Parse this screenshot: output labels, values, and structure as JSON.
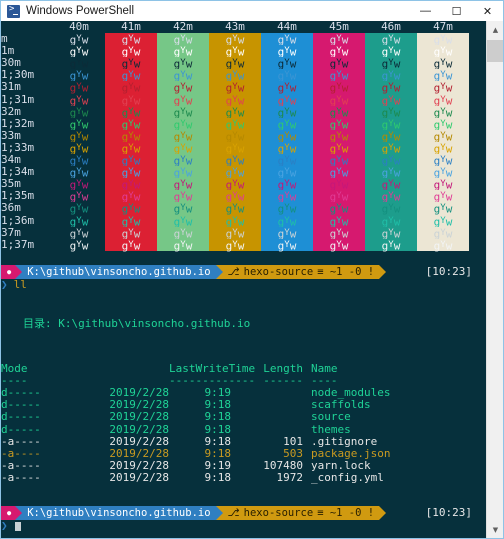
{
  "window": {
    "title": "Windows PowerShell",
    "icon": "powershell-icon",
    "minimize_label": "—",
    "maximize_label": "☐",
    "close_label": "✕"
  },
  "scrollbar": {
    "up_arrow": "▲",
    "down_arrow": "▼"
  },
  "color_chart": {
    "headers": [
      "",
      "40m",
      "41m",
      "42m",
      "43m",
      "44m",
      "45m",
      "46m",
      "47m"
    ],
    "sample_text": "gYw",
    "row_labels": [
      "m",
      "1m",
      "30m",
      "1;30m",
      "31m",
      "1;31m",
      "32m",
      "1;32m",
      "33m",
      "1;33m",
      "34m",
      "1;34m",
      "35m",
      "1;35m",
      "36m",
      "1;36m",
      "37m",
      "1;37m"
    ],
    "bg_colors": [
      "#06303c",
      "#dc2033",
      "#76c787",
      "#c79400",
      "#1e8fd5",
      "#d6196f",
      "#1d9d8c",
      "#ece6d4"
    ],
    "fg_colors": [
      "#d8dee9",
      "#ffffff",
      "#0c2b38",
      "#3b95d4",
      "#b32030",
      "#e14152",
      "#1d8a4e",
      "#2fcb6e",
      "#b58900",
      "#d8a200",
      "#2b7fc4",
      "#4aa3e0",
      "#c4187a",
      "#e03c95",
      "#14907f",
      "#1fbfa8",
      "#cbd3d6",
      "#f2f4f5"
    ]
  },
  "prompt_top": {
    "status_glyph": "●",
    "path": "K:\\github\\vinsoncho.github.io",
    "git_branch_glyph": "⎇",
    "git_branch": "hexo-source",
    "git_status": "≡ ~1 -0 !",
    "time": "[10:23]",
    "chevron": "❯",
    "command": "ll"
  },
  "listing": {
    "directory_label": "目录: K:\\github\\vinsoncho.github.io",
    "headers": {
      "mode": "Mode",
      "lastwritetime": "LastWriteTime",
      "length": "Length",
      "name": "Name"
    },
    "header_rules": {
      "mode": "----",
      "lastwritetime": "-------------",
      "length": "------",
      "name": "----"
    },
    "rows": [
      {
        "mode": "d-----",
        "date": "2019/2/28",
        "time": "9:19",
        "length": "",
        "name": "node_modules",
        "color": "#1fd396"
      },
      {
        "mode": "d-----",
        "date": "2019/2/28",
        "time": "9:18",
        "length": "",
        "name": "scaffolds",
        "color": "#1fd396"
      },
      {
        "mode": "d-----",
        "date": "2019/2/28",
        "time": "9:18",
        "length": "",
        "name": "source",
        "color": "#1fd396"
      },
      {
        "mode": "d-----",
        "date": "2019/2/28",
        "time": "9:18",
        "length": "",
        "name": "themes",
        "color": "#1fd396"
      },
      {
        "mode": "-a----",
        "date": "2019/2/28",
        "time": "9:18",
        "length": "101",
        "name": ".gitignore",
        "color": "#e6e6e6"
      },
      {
        "mode": "-a----",
        "date": "2019/2/28",
        "time": "9:18",
        "length": "503",
        "name": "package.json",
        "color": "#c99a21"
      },
      {
        "mode": "-a----",
        "date": "2019/2/28",
        "time": "9:19",
        "length": "107480",
        "name": "yarn.lock",
        "color": "#e6e6e6"
      },
      {
        "mode": "-a----",
        "date": "2019/2/28",
        "time": "9:18",
        "length": "1972",
        "name": "_config.yml",
        "color": "#e6e6e6"
      }
    ]
  },
  "prompt_bottom": {
    "status_glyph": "●",
    "path": "K:\\github\\vinsoncho.github.io",
    "git_branch_glyph": "⎇",
    "git_branch": "hexo-source",
    "git_status": "≡ ~1 -0 !",
    "time": "[10:23]",
    "chevron": "❯"
  },
  "colors": {
    "terminal_bg": "#06303c",
    "path_segment_bg": "#2f7fc1",
    "status_segment_bg": "#d6196f",
    "git_segment_bg": "#d09a10",
    "path_text": "#ffffff",
    "git_text": "#2b2100"
  }
}
